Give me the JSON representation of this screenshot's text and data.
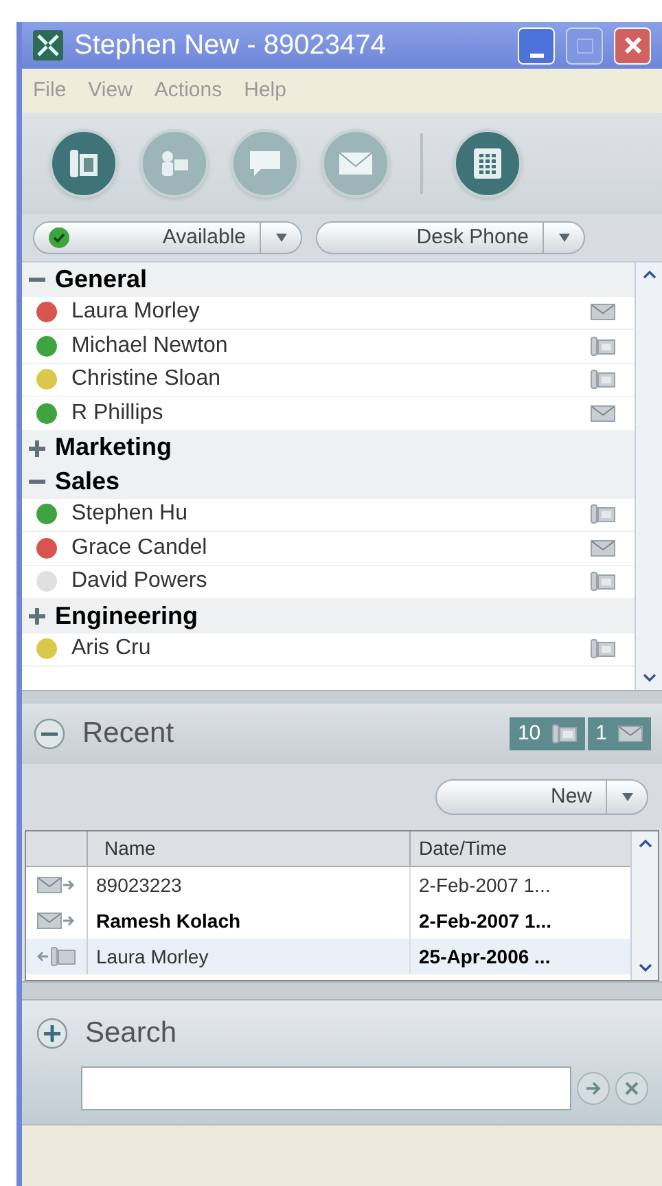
{
  "window": {
    "title": "Stephen New - 89023474"
  },
  "menu": [
    "File",
    "View",
    "Actions",
    "Help"
  ],
  "toolbar": [
    {
      "kind": "phone",
      "selected": true
    },
    {
      "kind": "contact",
      "selected": false
    },
    {
      "kind": "chat",
      "selected": false
    },
    {
      "kind": "email",
      "selected": false
    },
    {
      "kind": "dialpad",
      "selected": true
    }
  ],
  "status_selectors": [
    {
      "label": "Available",
      "kind": "presence"
    },
    {
      "label": "Desk Phone",
      "kind": "device"
    }
  ],
  "contacts": [
    {
      "group": "General",
      "expanded": true,
      "children": [
        {
          "name": "Laura Morley",
          "color": "#d9534f",
          "kind": "email"
        },
        {
          "name": "Michael Newton",
          "color": "#3fa33f",
          "kind": "phone"
        },
        {
          "name": "Christine Sloan",
          "color": "#d9c84a",
          "kind": "phone"
        },
        {
          "name": "R Phillips",
          "color": "#3fa33f",
          "kind": "email"
        }
      ]
    },
    {
      "group": "Marketing",
      "expanded": false
    },
    {
      "group": "Sales",
      "expanded": true,
      "children": [
        {
          "name": "Stephen Hu",
          "color": "#3fa33f",
          "kind": "phone"
        },
        {
          "name": "Grace Candel",
          "color": "#d9534f",
          "kind": "email"
        },
        {
          "name": "David Powers",
          "color": "#e0e0e0",
          "kind": "phone"
        }
      ]
    },
    {
      "group": "Engineering",
      "expanded": false
    }
  ],
  "ungrouped_contacts": [
    {
      "name": "Aris Cru",
      "color": "#d9c84a",
      "kind": "phone"
    }
  ],
  "recent": {
    "title": "Recent",
    "expanded": true,
    "counters": [
      {
        "count": "10",
        "kind": "phone"
      },
      {
        "count": "1",
        "kind": "email"
      }
    ],
    "new_button": "New",
    "columns": [
      "Name",
      "Date/Time"
    ],
    "rows": [
      {
        "kind": "email-out",
        "name": "89023223",
        "date": "2-Feb-2007 1...",
        "name_bold": false,
        "date_bold": false,
        "selected": false
      },
      {
        "kind": "email-out",
        "name": "Ramesh Kolach",
        "date": "2-Feb-2007 1...",
        "name_bold": true,
        "date_bold": true,
        "selected": false
      },
      {
        "kind": "phone-in",
        "name": "Laura Morley",
        "date": "25-Apr-2006 ...",
        "name_bold": false,
        "date_bold": true,
        "selected": true
      }
    ]
  },
  "search": {
    "title": "Search",
    "expanded": false
  }
}
